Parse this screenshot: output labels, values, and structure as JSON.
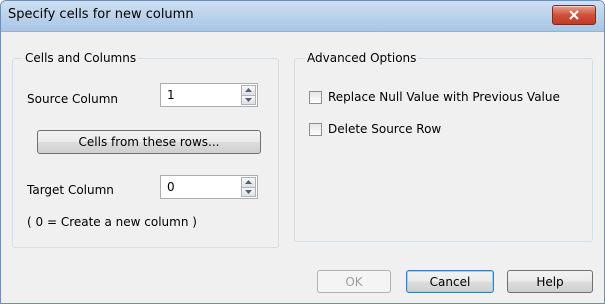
{
  "window": {
    "title": "Specify cells for new column"
  },
  "cells_group": {
    "legend": "Cells and Columns",
    "source_label": "Source Column",
    "source_value": "1",
    "cells_button": "Cells from these rows...",
    "target_label": "Target Column",
    "target_value": "0",
    "hint": "( 0 = Create a new column )"
  },
  "advanced_group": {
    "legend": "Advanced Options",
    "replace_null_label": "Replace Null Value with Previous Value",
    "replace_null_checked": false,
    "delete_source_label": "Delete Source Row",
    "delete_source_checked": false
  },
  "footer": {
    "ok_label": "OK",
    "cancel_label": "Cancel",
    "help_label": "Help"
  },
  "colors": {
    "close_button": "#c0392b",
    "titlebar": "#b9d1ea",
    "default_button_border": "#3c7fb1"
  }
}
